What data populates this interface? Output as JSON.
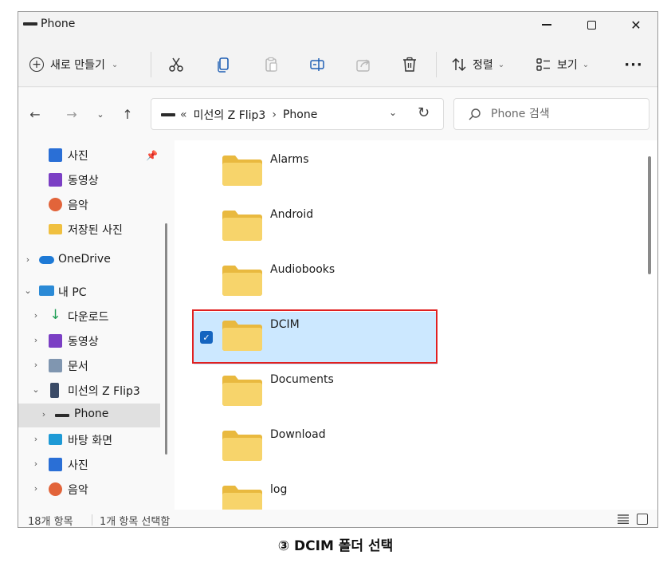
{
  "window": {
    "title": "Phone",
    "minimize_glyph": "—",
    "close_glyph": "✕"
  },
  "command_bar": {
    "new_label": "새로 만들기",
    "new_chevron": "⌄",
    "sort_label": "정렬",
    "sort_chevron": "⌄",
    "view_label": "보기",
    "view_chevron": "⌄",
    "more_label": "···",
    "icons": [
      "cut-icon",
      "copy-icon",
      "paste-icon",
      "rename-icon",
      "share-icon",
      "delete-icon",
      "sort-icon",
      "view-icon"
    ]
  },
  "address": {
    "back": "←",
    "forward": "→",
    "recent": "⌄",
    "up": "↑",
    "crumbs": [
      "«",
      "미선의 Z Flip3",
      "›",
      "Phone"
    ],
    "dropdown": "⌄",
    "refresh": "↻",
    "search_placeholder": "Phone 검색"
  },
  "sidebar": {
    "items": [
      {
        "label": "사진",
        "icon": "photos-icon",
        "color": "#2a6fd6",
        "pinned": true
      },
      {
        "label": "동영상",
        "icon": "videos-icon",
        "color": "#7b3fc4"
      },
      {
        "label": "음악",
        "icon": "music-icon",
        "color": "#e2643a"
      },
      {
        "label": "저장된 사진",
        "icon": "folder-icon",
        "color": "#f0c040"
      },
      {
        "label": "OneDrive",
        "icon": "onedrive-icon",
        "color": "#1e7ad6"
      },
      {
        "label": "내 PC",
        "icon": "pc-icon",
        "color": "#2b8ad6"
      },
      {
        "label": "다운로드",
        "icon": "download-icon",
        "color": "#1f9e55"
      },
      {
        "label": "동영상",
        "icon": "videos-icon",
        "color": "#7b3fc4"
      },
      {
        "label": "문서",
        "icon": "documents-icon",
        "color": "#8096b0"
      },
      {
        "label": "미선의 Z Flip3",
        "icon": "phone-icon",
        "color": "#3a4a66"
      },
      {
        "label": "Phone",
        "icon": "phone-storage-icon",
        "color": "#2b2b2b"
      },
      {
        "label": "바탕 화면",
        "icon": "desktop-icon",
        "color": "#1e9ad6"
      },
      {
        "label": "사진",
        "icon": "photos-icon",
        "color": "#2a6fd6"
      },
      {
        "label": "음악",
        "icon": "music-icon",
        "color": "#e2643a"
      }
    ],
    "chevron_collapsed": "›",
    "chevron_expanded": "⌄"
  },
  "folders": [
    {
      "name": "Alarms",
      "selected": false
    },
    {
      "name": "Android",
      "selected": false
    },
    {
      "name": "Audiobooks",
      "selected": false
    },
    {
      "name": "DCIM",
      "selected": true
    },
    {
      "name": "Documents",
      "selected": false
    },
    {
      "name": "Download",
      "selected": false
    },
    {
      "name": "log",
      "selected": false
    }
  ],
  "status": {
    "item_count": "18개 항목",
    "selection": "1개 항목 선택함"
  },
  "colors": {
    "selection_bg": "#cce8ff",
    "highlight_border": "#e02020",
    "folder_yellow": "#f7d46b",
    "folder_tab": "#e9b93f"
  },
  "caption": "③ DCIM 폴더 선택"
}
